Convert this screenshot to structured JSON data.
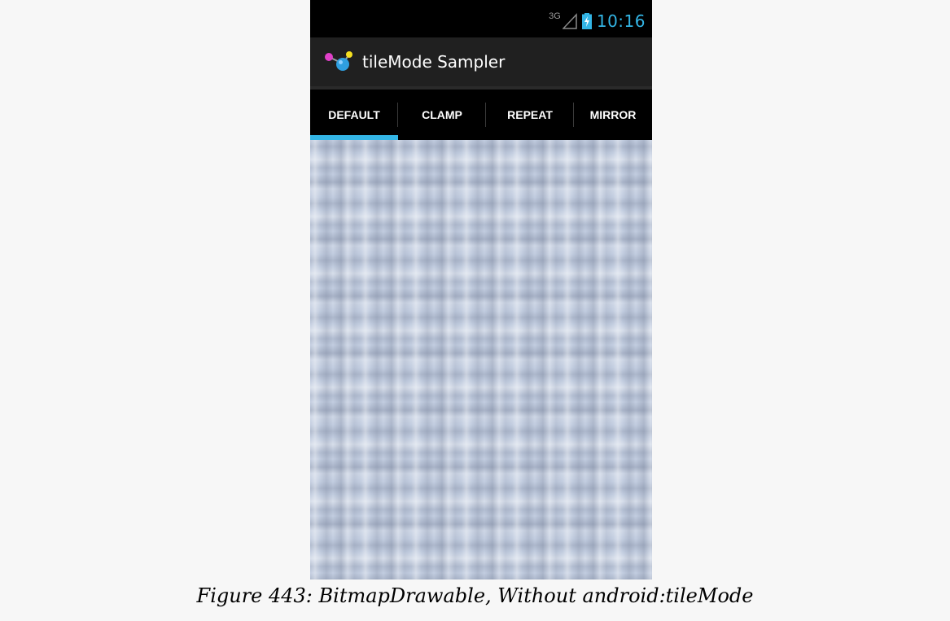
{
  "status_bar": {
    "network": "3G",
    "time": "10:16",
    "signal_icon": "signal-icon",
    "battery_icon": "battery-charging-icon",
    "accent_color": "#33b5e5"
  },
  "action_bar": {
    "app_icon": "molecule-app-icon",
    "title": "tileMode Sampler"
  },
  "tabs": [
    {
      "label": "DEFAULT",
      "selected": true
    },
    {
      "label": "CLAMP",
      "selected": false
    },
    {
      "label": "REPEAT",
      "selected": false
    },
    {
      "label": "MIRROR",
      "selected": false
    }
  ],
  "content": {
    "description_color": "#c2cde0"
  },
  "caption": "Figure 443: BitmapDrawable, Without android:tileMode"
}
